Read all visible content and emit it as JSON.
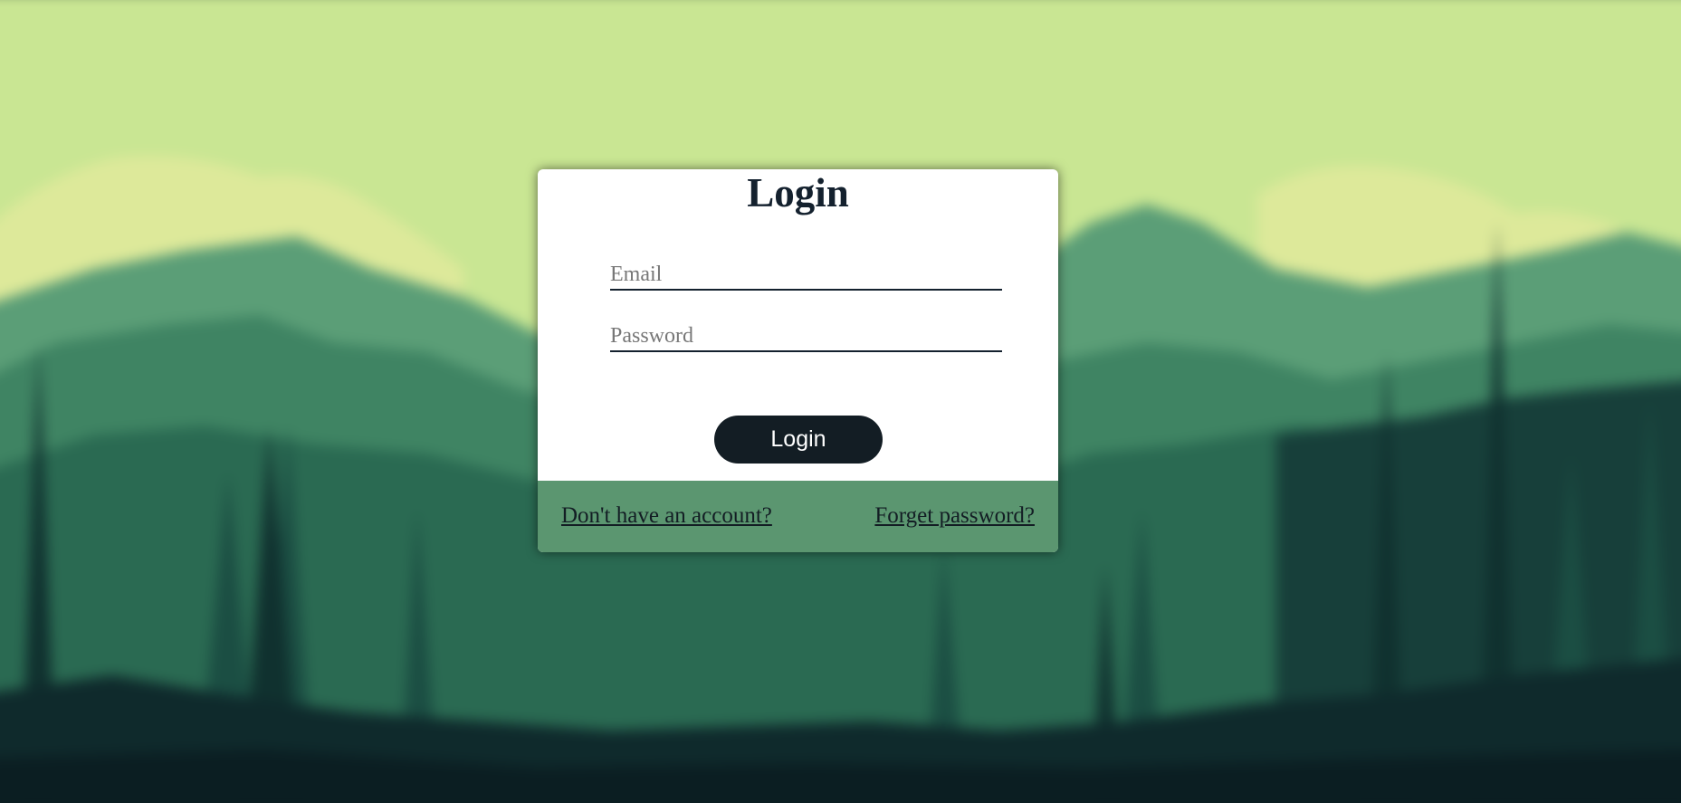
{
  "login": {
    "title": "Login",
    "email_placeholder": "Email",
    "password_placeholder": "Password",
    "submit_label": "Login",
    "signup_link": "Don't have an account?",
    "forgot_link": "Forget password?"
  },
  "colors": {
    "card_background": "#ffffff",
    "footer_background": "#5b9670",
    "button_background": "#131d24",
    "text_dark": "#14212e",
    "sky": "#c9e693"
  }
}
